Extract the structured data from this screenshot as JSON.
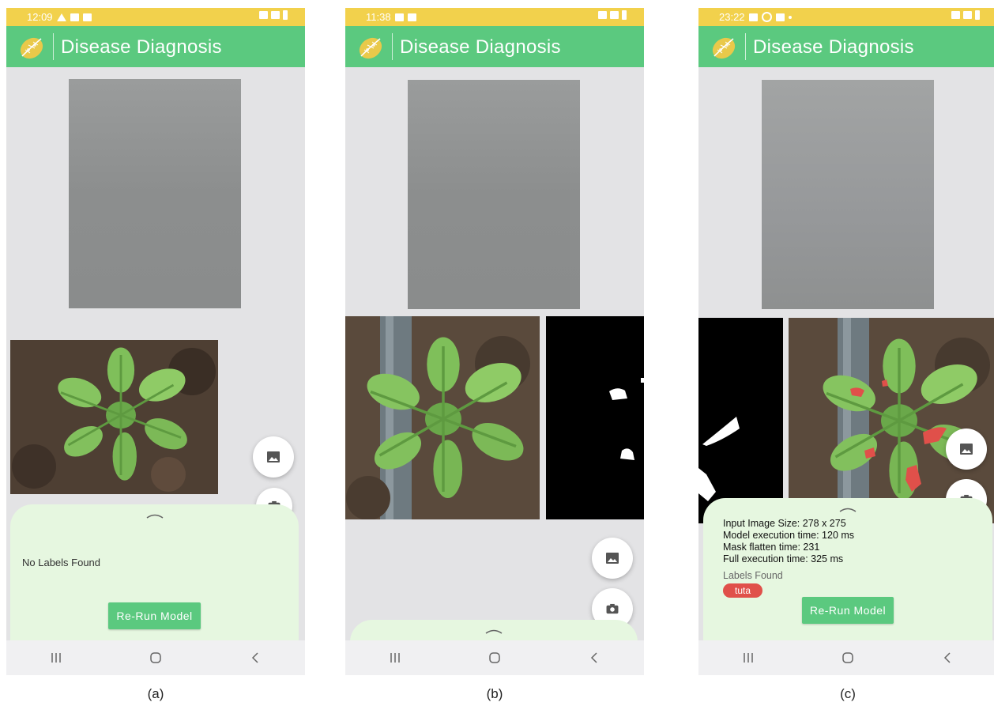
{
  "app": {
    "title": "Disease Diagnosis"
  },
  "colors": {
    "status_bar": "#f2d14c",
    "app_bar": "#5bc97f",
    "sheet": "#e6f7e0",
    "button": "#5bc97f",
    "chip": "#e0504a",
    "background": "#e3e3e5"
  },
  "screens": [
    {
      "caption": "(a)",
      "status_time": "12:09",
      "sheet": {
        "message": "No Labels Found",
        "button_label": "Re-Run Model"
      }
    },
    {
      "caption": "(b)",
      "status_time": "11:38"
    },
    {
      "caption": "(c)",
      "status_time": "23:22",
      "sheet": {
        "info": [
          "Input Image Size: 278 x 275",
          "Model execution time: 120 ms",
          "Mask flatten time: 231",
          "Full execution time: 325 ms"
        ],
        "labels_title": "Labels Found",
        "labels": [
          "tuta"
        ],
        "button_label": "Re-Run Model"
      }
    }
  ],
  "icons": {
    "gallery": "gallery-icon",
    "camera": "camera-icon",
    "recents": "recent-apps-icon",
    "home": "home-icon",
    "back": "back-icon"
  }
}
